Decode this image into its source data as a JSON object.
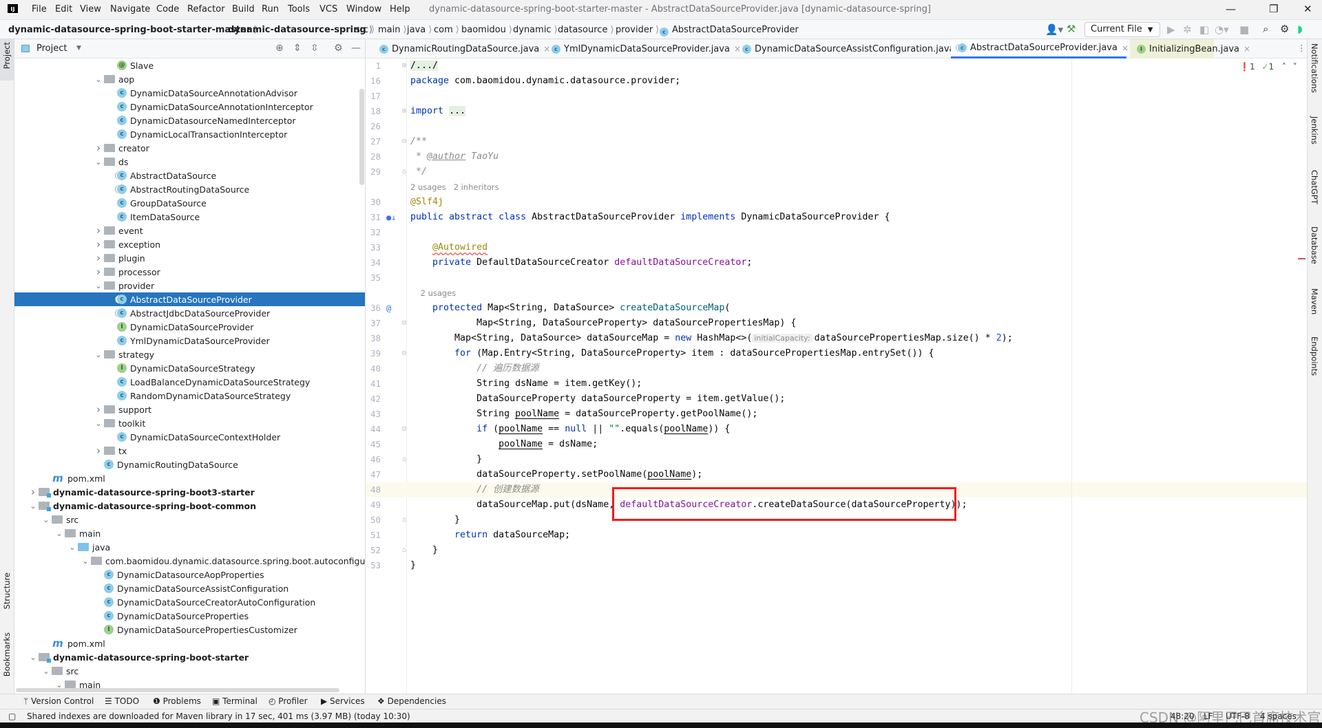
{
  "app": {
    "title": "dynamic-datasource-spring-boot-starter-master - AbstractDataSourceProvider.java [dynamic-datasource-spring]",
    "logo": "IJ"
  },
  "menu": [
    "File",
    "Edit",
    "View",
    "Navigate",
    "Code",
    "Refactor",
    "Build",
    "Run",
    "Tools",
    "VCS",
    "Window",
    "Help"
  ],
  "breadcrumb": [
    "dynamic-datasource-spring-boot-starter-master",
    "dynamic-datasource-spring",
    "src",
    "main",
    "java",
    "com",
    "baomidou",
    "dynamic",
    "datasource",
    "provider",
    "AbstractDataSourceProvider"
  ],
  "toolbar": {
    "run_config": "Current File"
  },
  "left_strip": [
    "Project",
    "Structure",
    "Bookmarks"
  ],
  "right_strip": [
    "Notifications",
    "Jenkins",
    "ChatGPT",
    "Database",
    "Maven",
    "Endpoints"
  ],
  "project": {
    "title": "Project",
    "rows": [
      {
        "label": "Slave",
        "d": 6,
        "icon": "annot"
      },
      {
        "label": "aop",
        "d": 5,
        "icon": "folder",
        "exp": true
      },
      {
        "label": "DynamicDataSourceAnnotationAdvisor",
        "d": 6,
        "icon": "class"
      },
      {
        "label": "DynamicDataSourceAnnotationInterceptor",
        "d": 6,
        "icon": "class"
      },
      {
        "label": "DynamicDatasourceNamedInterceptor",
        "d": 6,
        "icon": "class"
      },
      {
        "label": "DynamicLocalTransactionInterceptor",
        "d": 6,
        "icon": "class"
      },
      {
        "label": "creator",
        "d": 5,
        "icon": "folder",
        "exp": false
      },
      {
        "label": "ds",
        "d": 5,
        "icon": "folder",
        "exp": true
      },
      {
        "label": "AbstractDataSource",
        "d": 6,
        "icon": "abstract"
      },
      {
        "label": "AbstractRoutingDataSource",
        "d": 6,
        "icon": "abstract"
      },
      {
        "label": "GroupDataSource",
        "d": 6,
        "icon": "class"
      },
      {
        "label": "ItemDataSource",
        "d": 6,
        "icon": "class"
      },
      {
        "label": "event",
        "d": 5,
        "icon": "folder",
        "exp": false
      },
      {
        "label": "exception",
        "d": 5,
        "icon": "folder",
        "exp": false
      },
      {
        "label": "plugin",
        "d": 5,
        "icon": "folder",
        "exp": false
      },
      {
        "label": "processor",
        "d": 5,
        "icon": "folder",
        "exp": false
      },
      {
        "label": "provider",
        "d": 5,
        "icon": "folder",
        "exp": true
      },
      {
        "label": "AbstractDataSourceProvider",
        "d": 6,
        "icon": "abstract",
        "selected": true
      },
      {
        "label": "AbstractJdbcDataSourceProvider",
        "d": 6,
        "icon": "abstract"
      },
      {
        "label": "DynamicDataSourceProvider",
        "d": 6,
        "icon": "iface"
      },
      {
        "label": "YmlDynamicDataSourceProvider",
        "d": 6,
        "icon": "class"
      },
      {
        "label": "strategy",
        "d": 5,
        "icon": "folder",
        "exp": true
      },
      {
        "label": "DynamicDataSourceStrategy",
        "d": 6,
        "icon": "iface"
      },
      {
        "label": "LoadBalanceDynamicDataSourceStrategy",
        "d": 6,
        "icon": "class"
      },
      {
        "label": "RandomDynamicDataSourceStrategy",
        "d": 6,
        "icon": "class"
      },
      {
        "label": "support",
        "d": 5,
        "icon": "folder",
        "exp": false
      },
      {
        "label": "toolkit",
        "d": 5,
        "icon": "folder",
        "exp": true
      },
      {
        "label": "DynamicDataSourceContextHolder",
        "d": 6,
        "icon": "class"
      },
      {
        "label": "tx",
        "d": 5,
        "icon": "folder",
        "exp": false
      },
      {
        "label": "DynamicRoutingDataSource",
        "d": 5,
        "icon": "class"
      },
      {
        "label": "pom.xml",
        "d": 1,
        "icon": "maven"
      },
      {
        "label": "dynamic-datasource-spring-boot3-starter",
        "d": 0,
        "icon": "module",
        "exp": false,
        "bold": true
      },
      {
        "label": "dynamic-datasource-spring-boot-common",
        "d": 0,
        "icon": "module",
        "exp": true,
        "bold": true
      },
      {
        "label": "src",
        "d": 1,
        "icon": "folder",
        "exp": true
      },
      {
        "label": "main",
        "d": 2,
        "icon": "folder",
        "exp": true
      },
      {
        "label": "java",
        "d": 3,
        "icon": "src",
        "exp": true
      },
      {
        "label": "com.baomidou.dynamic.datasource.spring.boot.autoconfigure",
        "d": 4,
        "icon": "pkg",
        "exp": true
      },
      {
        "label": "DynamicDatasourceAopProperties",
        "d": 5,
        "icon": "class"
      },
      {
        "label": "DynamicDataSourceAssistConfiguration",
        "d": 5,
        "icon": "class"
      },
      {
        "label": "DynamicDataSourceCreatorAutoConfiguration",
        "d": 5,
        "icon": "class"
      },
      {
        "label": "DynamicDataSourceProperties",
        "d": 5,
        "icon": "class"
      },
      {
        "label": "DynamicDataSourcePropertiesCustomizer",
        "d": 5,
        "icon": "iface"
      },
      {
        "label": "pom.xml",
        "d": 1,
        "icon": "maven"
      },
      {
        "label": "dynamic-datasource-spring-boot-starter",
        "d": 0,
        "icon": "module",
        "exp": true,
        "bold": true
      },
      {
        "label": "src",
        "d": 1,
        "icon": "folder",
        "exp": true
      },
      {
        "label": "main",
        "d": 2,
        "icon": "folder",
        "exp": true
      }
    ]
  },
  "tabs": [
    {
      "label": "DynamicRoutingDataSource.java",
      "icon": "class"
    },
    {
      "label": "YmlDynamicDataSourceProvider.java",
      "icon": "class"
    },
    {
      "label": "DynamicDataSourceAssistConfiguration.java",
      "icon": "class"
    },
    {
      "label": "AbstractDataSourceProvider.java",
      "icon": "abstract",
      "active": true
    },
    {
      "label": "InitializingBean.java",
      "icon": "iface",
      "ext": true
    }
  ],
  "inspections": {
    "errors": "1",
    "warnings": "1"
  },
  "code": [
    {
      "n": "1",
      "fold": "⊞",
      "t": [
        [
          "/.../",
          "foldbox"
        ]
      ]
    },
    {
      "n": "16",
      "t": [
        [
          "package",
          "kw"
        ],
        [
          " com.baomidou.dynamic.datasource.provider;",
          ""
        ]
      ]
    },
    {
      "n": "17",
      "t": []
    },
    {
      "n": "18",
      "fold": "⊞",
      "t": [
        [
          "import",
          "kw"
        ],
        [
          " ",
          ""
        ],
        [
          "...",
          "foldbox"
        ]
      ]
    },
    {
      "n": "26",
      "t": []
    },
    {
      "n": "27",
      "fold": "⊟",
      "t": [
        [
          "/**",
          "doc"
        ]
      ]
    },
    {
      "n": "28",
      "t": [
        [
          " * ",
          "doc"
        ],
        [
          "@author",
          "doctag"
        ],
        [
          " TaoYu",
          "doc"
        ]
      ]
    },
    {
      "n": "29",
      "fold": "⌂",
      "t": [
        [
          " */",
          "doc"
        ]
      ]
    },
    {
      "n": "",
      "hint": "2 usages   2 inheritors",
      "t": []
    },
    {
      "n": "30",
      "t": [
        [
          "@Slf4j",
          "ann"
        ]
      ]
    },
    {
      "n": "31",
      "mark": "●↓",
      "t": [
        [
          "public abstract class",
          "kw"
        ],
        [
          " AbstractDataSourceProvider ",
          ""
        ],
        [
          "implements",
          "kw"
        ],
        [
          " DynamicDataSourceProvider {",
          ""
        ]
      ]
    },
    {
      "n": "32",
      "t": []
    },
    {
      "n": "33",
      "t": [
        [
          "    ",
          ""
        ],
        [
          "@Autowired",
          "ann err"
        ]
      ]
    },
    {
      "n": "34",
      "t": [
        [
          "    ",
          ""
        ],
        [
          "private",
          "kw"
        ],
        [
          " DefaultDataSourceCreator ",
          ""
        ],
        [
          "defaultDataSourceCreator",
          "fld"
        ],
        [
          ";",
          ""
        ]
      ]
    },
    {
      "n": "35",
      "t": []
    },
    {
      "n": "",
      "hint": "    2 usages",
      "t": []
    },
    {
      "n": "36",
      "mark": "@",
      "t": [
        [
          "    ",
          ""
        ],
        [
          "protected",
          "kw"
        ],
        [
          " Map<String, DataSource> ",
          ""
        ],
        [
          "createDataSourceMap",
          "mth"
        ],
        [
          "(",
          ""
        ]
      ]
    },
    {
      "n": "37",
      "fold": "⊟",
      "t": [
        [
          "            Map<String, DataSourceProperty> dataSourcePropertiesMap) {",
          ""
        ]
      ]
    },
    {
      "n": "38",
      "t": [
        [
          "        Map<String, DataSource> dataSourceMap = ",
          ""
        ],
        [
          "new",
          "kw"
        ],
        [
          " HashMap<>(",
          ""
        ],
        [
          "initialCapacity:",
          "inlay"
        ],
        [
          "dataSourcePropertiesMap.size() * ",
          ""
        ],
        [
          "2",
          "num"
        ],
        [
          ");",
          ""
        ]
      ]
    },
    {
      "n": "39",
      "fold": "⊟",
      "t": [
        [
          "        ",
          ""
        ],
        [
          "for",
          "kw"
        ],
        [
          " (Map.Entry<String, DataSourceProperty> item : dataSourcePropertiesMap.entrySet()) {",
          ""
        ]
      ]
    },
    {
      "n": "40",
      "t": [
        [
          "            ",
          ""
        ],
        [
          "// 遍历数据源",
          "cm"
        ]
      ]
    },
    {
      "n": "41",
      "t": [
        [
          "            String dsName = item.getKey();",
          ""
        ]
      ]
    },
    {
      "n": "42",
      "t": [
        [
          "            DataSourceProperty dataSourceProperty = item.getValue();",
          ""
        ]
      ]
    },
    {
      "n": "43",
      "t": [
        [
          "            String ",
          ""
        ],
        [
          "poolName",
          "uv"
        ],
        [
          " = dataSourceProperty.getPoolName();",
          ""
        ]
      ]
    },
    {
      "n": "44",
      "fold": "⊟",
      "t": [
        [
          "            ",
          ""
        ],
        [
          "if",
          "kw"
        ],
        [
          " (",
          ""
        ],
        [
          "poolName",
          "uv"
        ],
        [
          " == ",
          ""
        ],
        [
          "null",
          "kw"
        ],
        [
          " || ",
          ""
        ],
        [
          "\"\"",
          "str"
        ],
        [
          ".equals(",
          ""
        ],
        [
          "poolName",
          "uv"
        ],
        [
          ")) {",
          ""
        ]
      ]
    },
    {
      "n": "45",
      "t": [
        [
          "                ",
          ""
        ],
        [
          "poolName",
          "uv"
        ],
        [
          " = dsName;",
          ""
        ]
      ]
    },
    {
      "n": "46",
      "fold": "⌂",
      "t": [
        [
          "            }",
          ""
        ]
      ]
    },
    {
      "n": "47",
      "t": [
        [
          "            dataSourceProperty.setPoolName(",
          ""
        ],
        [
          "poolName",
          "uv"
        ],
        [
          ");",
          ""
        ]
      ]
    },
    {
      "n": "48",
      "cur": true,
      "t": [
        [
          "            ",
          ""
        ],
        [
          "// 创建数据源",
          "cm"
        ]
      ]
    },
    {
      "n": "49",
      "t": [
        [
          "            dataSourceMap.put(dsName, ",
          ""
        ],
        [
          "defaultDataSourceCreator",
          "fld"
        ],
        [
          ".createDataSource(dataSourceProperty));",
          ""
        ]
      ]
    },
    {
      "n": "50",
      "fold": "⌂",
      "t": [
        [
          "        }",
          ""
        ]
      ]
    },
    {
      "n": "51",
      "t": [
        [
          "        ",
          ""
        ],
        [
          "return",
          "kw"
        ],
        [
          " dataSourceMap;",
          ""
        ]
      ]
    },
    {
      "n": "52",
      "fold": "⌂",
      "t": [
        [
          "    }",
          ""
        ]
      ]
    },
    {
      "n": "53",
      "t": [
        [
          "}",
          ""
        ]
      ]
    }
  ],
  "bottom_tools": [
    "Version Control",
    "TODO",
    "Problems",
    "Terminal",
    "Profiler",
    "Services",
    "Dependencies"
  ],
  "status": {
    "message": "Shared indexes are downloaded for Maven library in 17 sec, 401 ms (3.97 MB) (today 10:30)",
    "position": "48:20",
    "line_sep": "LF",
    "encoding": "UTF-8",
    "indent": "4 spaces"
  },
  "watermark": "CSDN @阿里巴巴首席技术官",
  "colors": {
    "accent": "#3574f0",
    "selection": "#2675bf",
    "highlight_box": "#f01c1c"
  }
}
